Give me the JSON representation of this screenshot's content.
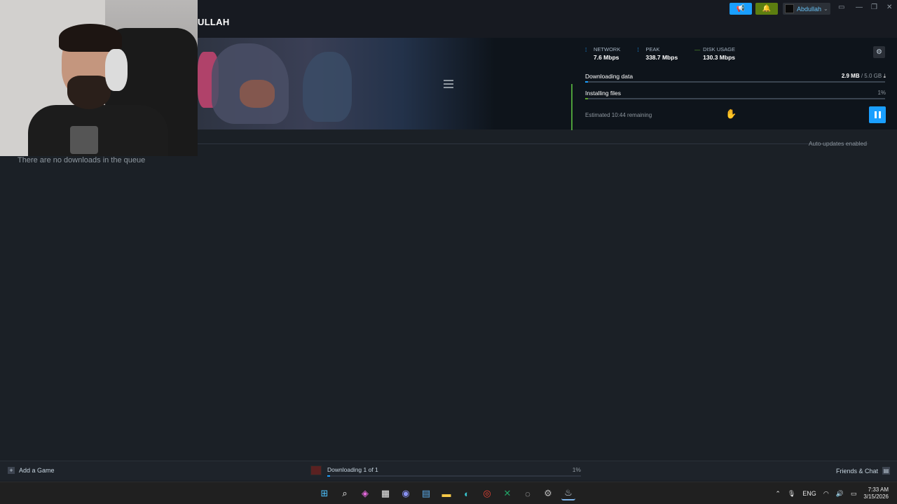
{
  "window": {
    "page_title": "ULLAH",
    "user_name": "Abdullah",
    "minimize": "—",
    "restore": "❐",
    "close": "✕",
    "monitor_icon": "▭"
  },
  "header": {
    "stats": [
      {
        "label": "NETWORK",
        "value": "7.6 Mbps",
        "color": "#1a9fff"
      },
      {
        "label": "PEAK",
        "value": "338.7 Mbps",
        "color": "#1a9fff"
      },
      {
        "label": "DISK USAGE",
        "value": "130.3 Mbps",
        "color": "#5ba32b"
      }
    ],
    "downloading_label": "Downloading data",
    "downloaded": "2.9 MB",
    "download_total": "/ 5.0 GB",
    "download_progress": 0.01,
    "installing_label": "Installing files",
    "installing_pct": "1%",
    "installing_progress": 0.01,
    "eta": "Estimated 10:44 remaining"
  },
  "content": {
    "auto_updates": "Auto-updates enabled",
    "empty_queue": "There are no downloads in the queue"
  },
  "bottom_bar": {
    "add_game": "Add a Game",
    "download_status": "Downloading 1 of 1",
    "download_pct": "1%",
    "download_progress": 0.01,
    "friends_chat": "Friends & Chat"
  },
  "taskbar": {
    "language": "ENG",
    "time": "7:33 AM",
    "date": "3/15/2026",
    "icons": [
      "windows-start-icon",
      "search-icon",
      "copilot-icon",
      "store-icon",
      "discord-icon",
      "notepad-icon",
      "file-explorer-icon",
      "edge-icon",
      "chrome-icon",
      "excel-icon",
      "app-icon",
      "settings-icon",
      "steam-icon"
    ]
  },
  "colors": {
    "accent": "#1a9fff",
    "notification": "#5c7e10",
    "background": "#1b2026"
  }
}
